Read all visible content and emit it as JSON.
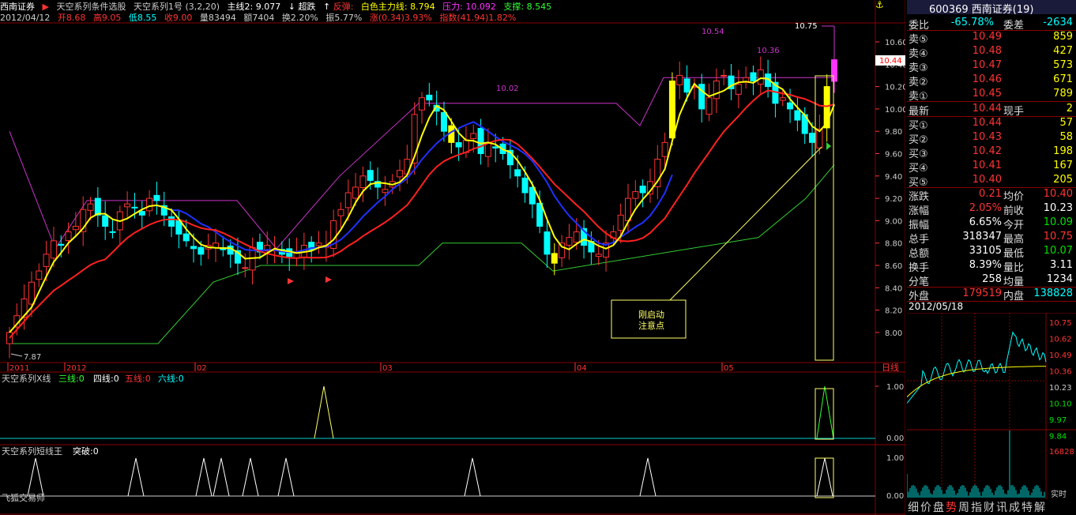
{
  "topbar": {
    "broker": "西南证券",
    "title": "天空系列条件选股",
    "indicator": "天空系列1号",
    "params": "(3,2,20)",
    "main2_label": "主线2:",
    "main2_value": "9.077",
    "over_label": "超跌",
    "rebound_label": "反弹:",
    "white_line": "白色主力线:",
    "white_value": "8.794",
    "pressure_label": "压力:",
    "pressure_value": "10.092",
    "support_label": "支撑:",
    "support_value": "8.545"
  },
  "infobar": {
    "date": "2012/04/12",
    "open": "开8.68",
    "high": "高9.05",
    "low": "低8.55",
    "close": "收9.00",
    "vol": "量83494",
    "amount": "额7404",
    "turnover": "换2.20%",
    "amplitude": "振5.77%",
    "change": "涨(0.34)3.93%",
    "index": "指数(41.94)1.82%"
  },
  "price_axis": [
    "10.60",
    "10.40",
    "10.20",
    "10.00",
    "9.80",
    "9.60",
    "9.40",
    "9.20",
    "9.00",
    "8.80",
    "8.60",
    "8.40",
    "8.20",
    "8.00"
  ],
  "date_axis": [
    "2011",
    "2012",
    "02",
    "03",
    "04",
    "05"
  ],
  "period_label": "日线",
  "annotations": {
    "high_10_54": "10.54",
    "high_10_36": "10.36",
    "high_10_75": "10.75",
    "mid_10_02": "10.02",
    "low_7_87": "7.87",
    "current_price": "10.44",
    "note_line1": "刚启动",
    "note_line2": "注意点"
  },
  "sub1": {
    "title": "天空系列X线",
    "line3": "三线:0",
    "line4": "四线:0",
    "line5": "五线:0",
    "line6": "六线:0",
    "axis": [
      "1.00",
      "0.00"
    ]
  },
  "sub2": {
    "title": "天空系列短线王",
    "breakout": "突破:0",
    "axis": [
      "1.00",
      "0.00"
    ],
    "watermark": "飞狐交易师"
  },
  "quote": {
    "code_name": "600369 西南证券(19)",
    "weibi_label": "委比",
    "weibi_value": "-65.78%",
    "weicha_label": "委差",
    "weicha_value": "-2634",
    "sell": [
      {
        "label": "卖⑤",
        "price": "10.49",
        "vol": "859"
      },
      {
        "label": "卖④",
        "price": "10.48",
        "vol": "427"
      },
      {
        "label": "卖③",
        "price": "10.47",
        "vol": "573"
      },
      {
        "label": "卖②",
        "price": "10.46",
        "vol": "671"
      },
      {
        "label": "卖①",
        "price": "10.45",
        "vol": "789"
      }
    ],
    "latest_label": "最新",
    "latest_value": "10.44",
    "cur_hand_label": "现手",
    "cur_hand_value": "2",
    "buy": [
      {
        "label": "买①",
        "price": "10.44",
        "vol": "57"
      },
      {
        "label": "买②",
        "price": "10.43",
        "vol": "58"
      },
      {
        "label": "买③",
        "price": "10.42",
        "vol": "198"
      },
      {
        "label": "买④",
        "price": "10.41",
        "vol": "167"
      },
      {
        "label": "买⑤",
        "price": "10.40",
        "vol": "205"
      }
    ],
    "stats": [
      {
        "l1": "涨跌",
        "v1": "0.21",
        "l2": "均价",
        "v2": "10.40",
        "c1": "red",
        "c2": "red"
      },
      {
        "l1": "涨幅",
        "v1": "2.05%",
        "l2": "前收",
        "v2": "10.23",
        "c1": "red",
        "c2": "white"
      },
      {
        "l1": "振幅",
        "v1": "6.65%",
        "l2": "今开",
        "v2": "10.09",
        "c1": "white",
        "c2": "green"
      },
      {
        "l1": "总手",
        "v1": "318347",
        "l2": "最高",
        "v2": "10.75",
        "c1": "white",
        "c2": "red"
      },
      {
        "l1": "总额",
        "v1": "33105",
        "l2": "最低",
        "v2": "10.07",
        "c1": "white",
        "c2": "green"
      },
      {
        "l1": "换手",
        "v1": "8.39%",
        "l2": "量比",
        "v2": "3.11",
        "c1": "white",
        "c2": "white"
      },
      {
        "l1": "分笔",
        "v1": "258",
        "l2": "均量",
        "v2": "1234",
        "c1": "white",
        "c2": "white"
      }
    ],
    "outer_label": "外盘",
    "outer_value": "179519",
    "inner_label": "内盘",
    "inner_value": "138828",
    "mini_date": "2012/05/18",
    "mini_axis": [
      "10.75",
      "10.62",
      "10.49",
      "10.36",
      "10.23",
      "10.10",
      "9.97",
      "9.84"
    ],
    "mini_vol_axis": "16828",
    "realtime": "实时"
  },
  "bottom_tabs": [
    "细",
    "价",
    "盘",
    "势",
    "周",
    "指",
    "财",
    "讯",
    "成",
    "特",
    "解"
  ],
  "colors": {
    "up": "#ff3333",
    "down": "#00ffff",
    "ma_yellow": "#ffff00",
    "ma_red": "#ff2020",
    "ma_blue": "#2030ff",
    "pressure": "#cc33cc",
    "support": "#33cc33",
    "grid": "#880000"
  }
}
